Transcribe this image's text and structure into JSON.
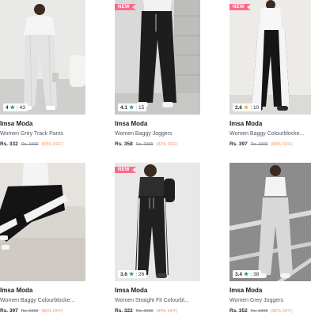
{
  "accent": {
    "new_tag": "#ff6a8a",
    "discount": "#ff905a",
    "star_teal": "#14958f",
    "star_gold": "#f5a623"
  },
  "products": [
    {
      "new": false,
      "rating": "4",
      "star_color": "teal",
      "rating_count": "43",
      "brand": "Imsa Moda",
      "name": "Women Grey Track Pants",
      "price": "Rs. 332",
      "mrp": "Rs. 1999",
      "discount": "(83% OFF)"
    },
    {
      "new": true,
      "new_label": "NEW",
      "rating": "4.1",
      "star_color": "teal",
      "rating_count": "15",
      "brand": "Imsa Moda",
      "name": "Women Baggy Joggers",
      "price": "Rs. 358",
      "mrp": "Rs. 1999",
      "discount": "(82% OFF)"
    },
    {
      "new": true,
      "new_label": "NEW",
      "rating": "2.6",
      "star_color": "gold",
      "rating_count": "10",
      "brand": "Imsa Moda",
      "name": "Women Baggy Colourblocke...",
      "price": "Rs. 397",
      "mrp": "Rs. 1999",
      "discount": "(80% OFF)"
    },
    {
      "new": false,
      "rating": "",
      "rating_count": "",
      "brand": "Imsa Moda",
      "name": "Women Baggy Colourblocke...",
      "price": "Rs. 397",
      "mrp": "Rs. 1999",
      "discount": "(80% OFF)"
    },
    {
      "new": true,
      "new_label": "NEW",
      "rating": "3.6",
      "star_color": "teal",
      "rating_count": "26",
      "brand": "Imsa Moda",
      "name": "Women Straight Fit Colourbl...",
      "price": "Rs. 322",
      "mrp": "Rs. 1999",
      "discount": "(84% OFF)"
    },
    {
      "new": false,
      "rating": "3.4",
      "star_color": "teal",
      "rating_count": "38",
      "brand": "Imsa Moda",
      "name": "Women Grey Joggers",
      "price": "Rs. 352",
      "mrp": "Rs. 1999",
      "discount": "(82% OFF)"
    }
  ]
}
